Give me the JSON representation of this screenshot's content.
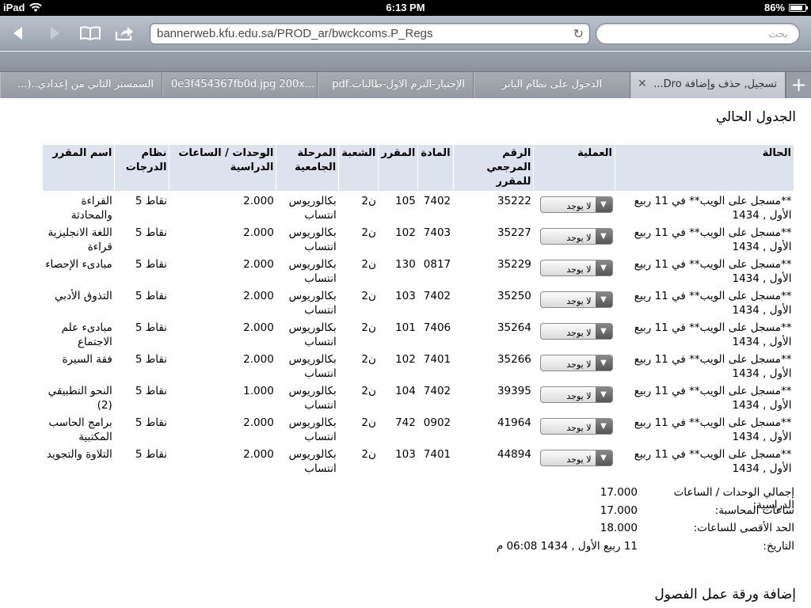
{
  "status_bar": {
    "device": "iPad",
    "time": "6:13 PM",
    "battery_percent": "86%",
    "battery_level": 0.86
  },
  "browser": {
    "url": "bannerweb.kfu.edu.sa/PROD_ar/bwckcoms.P_Regs",
    "search_placeholder": "بحث",
    "tabs": [
      {
        "label": "تسجيل, حذف وإضافة Dro...",
        "active": true
      },
      {
        "label": "الدخول على نظام البانر",
        "active": false
      },
      {
        "label": "الإختبار-الترم الاول-طالبات.pdf",
        "active": false
      },
      {
        "label": "0e3f454367fb0d.jpg 200x...",
        "active": false
      },
      {
        "label": "السمستر الثاني من إعدادي..(...",
        "active": false
      }
    ],
    "new_tab": "+"
  },
  "page": {
    "title": "الجدول الحالي",
    "table": {
      "headers": {
        "status": "الحالة",
        "action": "العملية",
        "crn": "الرقم المرجعي للمقرر",
        "subject": "المادة",
        "course": "المقرر",
        "section": "الشعبة",
        "level": "المرحلة الجامعية",
        "credits": "الوحدات / الساعات الدراسية",
        "grade_mode": "نظام الدرجات",
        "title": "اسم المقرر"
      },
      "rows": [
        {
          "status": "**مسجل على الويب** في 11 ربيع الأول , 1434",
          "action": "لا يوجد",
          "crn": "35222",
          "subject": "7402",
          "course": "105",
          "section": "ن2",
          "level": "بكالوريوس انتساب",
          "credits": "2.000",
          "grade_mode": "نقاط 5",
          "title": "القراءة والمحادثة"
        },
        {
          "status": "**مسجل على الويب** في 11 ربيع الأول , 1434",
          "action": "لا يوجد",
          "crn": "35227",
          "subject": "7403",
          "course": "102",
          "section": "ن2",
          "level": "بكالوريوس انتساب",
          "credits": "2.000",
          "grade_mode": "نقاط 5",
          "title": "اللغة الانجليزية قراءة"
        },
        {
          "status": "**مسجل على الويب** في 11 ربيع الأول , 1434",
          "action": "لا يوجد",
          "crn": "35229",
          "subject": "0817",
          "course": "130",
          "section": "ن2",
          "level": "بكالوريوس انتساب",
          "credits": "2.000",
          "grade_mode": "نقاط 5",
          "title": "مبادىء الإحصاء"
        },
        {
          "status": "**مسجل على الويب** في 11 ربيع الأول , 1434",
          "action": "لا يوجد",
          "crn": "35250",
          "subject": "7402",
          "course": "103",
          "section": "ن2",
          "level": "بكالوريوس انتساب",
          "credits": "2.000",
          "grade_mode": "نقاط 5",
          "title": "التذوق الأدبي"
        },
        {
          "status": "**مسجل على الويب** في 11 ربيع الأول , 1434",
          "action": "لا يوجد",
          "crn": "35264",
          "subject": "7406",
          "course": "101",
          "section": "ن2",
          "level": "بكالوريوس انتساب",
          "credits": "2.000",
          "grade_mode": "نقاط 5",
          "title": "مبادىء علم الاجتماع"
        },
        {
          "status": "**مسجل على الويب** في 11 ربيع الأول , 1434",
          "action": "لا يوجد",
          "crn": "35266",
          "subject": "7401",
          "course": "102",
          "section": "ن2",
          "level": "بكالوريوس انتساب",
          "credits": "2.000",
          "grade_mode": "نقاط 5",
          "title": "فقة السيرة"
        },
        {
          "status": "**مسجل على الويب** في 11 ربيع الأول , 1434",
          "action": "لا يوجد",
          "crn": "39395",
          "subject": "7402",
          "course": "104",
          "section": "ن2",
          "level": "بكالوريوس انتساب",
          "credits": "1.000",
          "grade_mode": "نقاط 5",
          "title": "النحو التطبيقي (2)"
        },
        {
          "status": "**مسجل على الويب** في 11 ربيع الأول , 1434",
          "action": "لا يوجد",
          "crn": "41964",
          "subject": "0902",
          "course": "742",
          "section": "ن2",
          "level": "بكالوريوس انتساب",
          "credits": "2.000",
          "grade_mode": "نقاط 5",
          "title": "برامج الحاسب المكتبية"
        },
        {
          "status": "**مسجل على الويب** في 11 ربيع الأول , 1434",
          "action": "لا يوجد",
          "crn": "44894",
          "subject": "7401",
          "course": "103",
          "section": "ن2",
          "level": "بكالوريوس انتساب",
          "credits": "2.000",
          "grade_mode": "نقاط 5",
          "title": "التلاوة والتجويد"
        }
      ]
    },
    "summary": [
      {
        "label": "إجمالي الوحدات / الساعات الدراسية:",
        "value": "17.000"
      },
      {
        "label": "ساعات المحاسبة:",
        "value": "17.000"
      },
      {
        "label": "الحد الأقصى للساعات:",
        "value": "18.000"
      },
      {
        "label": "التاريخ:",
        "value": "11 ربيع الأول , 1434 06:08 م"
      }
    ],
    "add_worksheet_title": "إضافة ورقة عمل الفصول"
  }
}
